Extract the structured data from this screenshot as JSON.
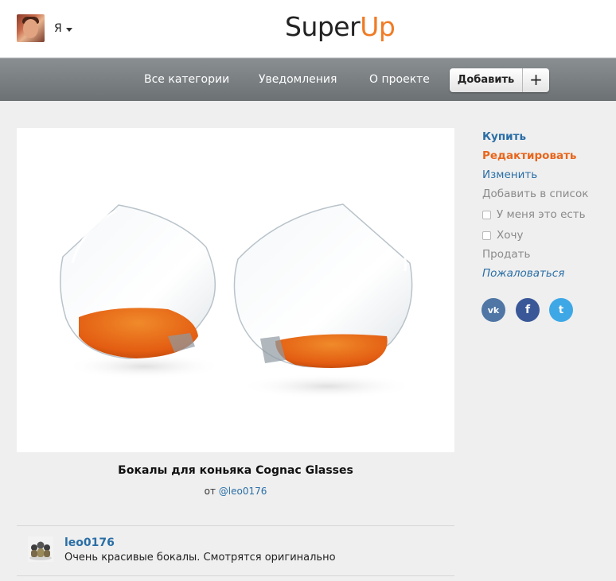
{
  "header": {
    "logo_part1": "Super",
    "logo_part2": "Up",
    "user_label": "Я"
  },
  "nav": {
    "all_categories": "Все категории",
    "notifications": "Уведомления",
    "about": "О проекте",
    "add_label": "Добавить",
    "plus_label": "+"
  },
  "product": {
    "title": "Бокалы для коньяка Cognac Glasses",
    "by_prefix": "от",
    "author_link": "@leo0176"
  },
  "sidebar": {
    "buy": "Купить",
    "edit": "Редактировать",
    "change": "Изменить",
    "add_to_list": "Добавить в список",
    "i_have_it": "У меня это есть",
    "want": "Хочу",
    "sell": "Продать",
    "report": "Пожаловаться"
  },
  "social": {
    "vk_label": "vk",
    "fb_label": "f",
    "tw_label": "t",
    "vk_color": "#4f76a5",
    "fb_color": "#3a5898",
    "tw_color": "#3ea8e6"
  },
  "comment": {
    "author": "leo0176",
    "text": "Очень красивые бокалы. Смотрятся оригинально"
  },
  "colors": {
    "accent_orange": "#f07b24",
    "link_blue": "#2a6ea6"
  }
}
